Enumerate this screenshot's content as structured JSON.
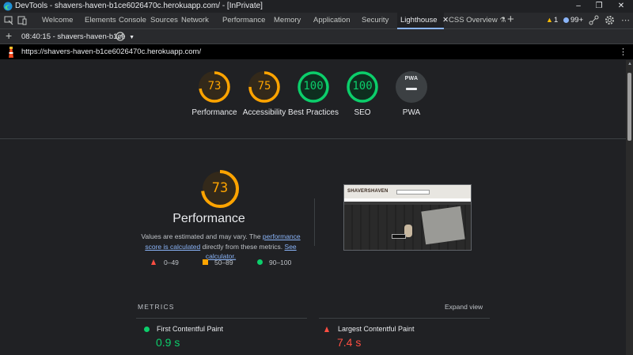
{
  "window": {
    "title": "DevTools - shavers-haven-b1ce6026470c.herokuapp.com/ - [InPrivate]"
  },
  "tabs": [
    {
      "label": "Welcome"
    },
    {
      "label": "Elements"
    },
    {
      "label": "Console"
    },
    {
      "label": "Sources"
    },
    {
      "label": "Network"
    },
    {
      "label": "Performance"
    },
    {
      "label": "Memory"
    },
    {
      "label": "Application"
    },
    {
      "label": "Security"
    },
    {
      "label": "Lighthouse",
      "active": true
    },
    {
      "label": "CSS Overview"
    }
  ],
  "status": {
    "warnings": "1",
    "issues": "99+"
  },
  "toolbar": {
    "report": "08:40:15 - shavers-haven-b1ce"
  },
  "url": "https://shavers-haven-b1ce6026470c.herokuapp.com/",
  "scores": [
    {
      "value": "73",
      "label": "Performance",
      "level": 0.73,
      "color": "#ffa400"
    },
    {
      "value": "75",
      "label": "Accessibility",
      "level": 0.75,
      "color": "#ffa400"
    },
    {
      "value": "100",
      "label": "Best Practices",
      "level": 1.0,
      "color": "#0cce6b"
    },
    {
      "value": "100",
      "label": "SEO",
      "level": 1.0,
      "color": "#0cce6b"
    },
    {
      "value": "PWA",
      "label": "PWA",
      "level": 0,
      "color": "#9aa0a6"
    }
  ],
  "performance": {
    "score": "73",
    "level": 0.73,
    "title": "Performance",
    "note_before": "Values are estimated and may vary. The ",
    "note_link1": "performance score is calculated",
    "note_middle": " directly from these metrics. ",
    "note_link2": "See calculator."
  },
  "legend": [
    {
      "range": "0–49",
      "color": "#ff4e42"
    },
    {
      "range": "50–89",
      "color": "#ffa400"
    },
    {
      "range": "90–100",
      "color": "#0cce6b"
    }
  ],
  "metrics": {
    "header": "METRICS",
    "toggle": "Expand view",
    "items": [
      {
        "name": "First Contentful Paint",
        "value": "0.9 s",
        "color": "#0cce6b"
      },
      {
        "name": "Largest Contentful Paint",
        "value": "7.4 s",
        "color": "#ff4e42"
      }
    ]
  },
  "thumbnail": {
    "brand": "SHAVERSHAVEN"
  }
}
